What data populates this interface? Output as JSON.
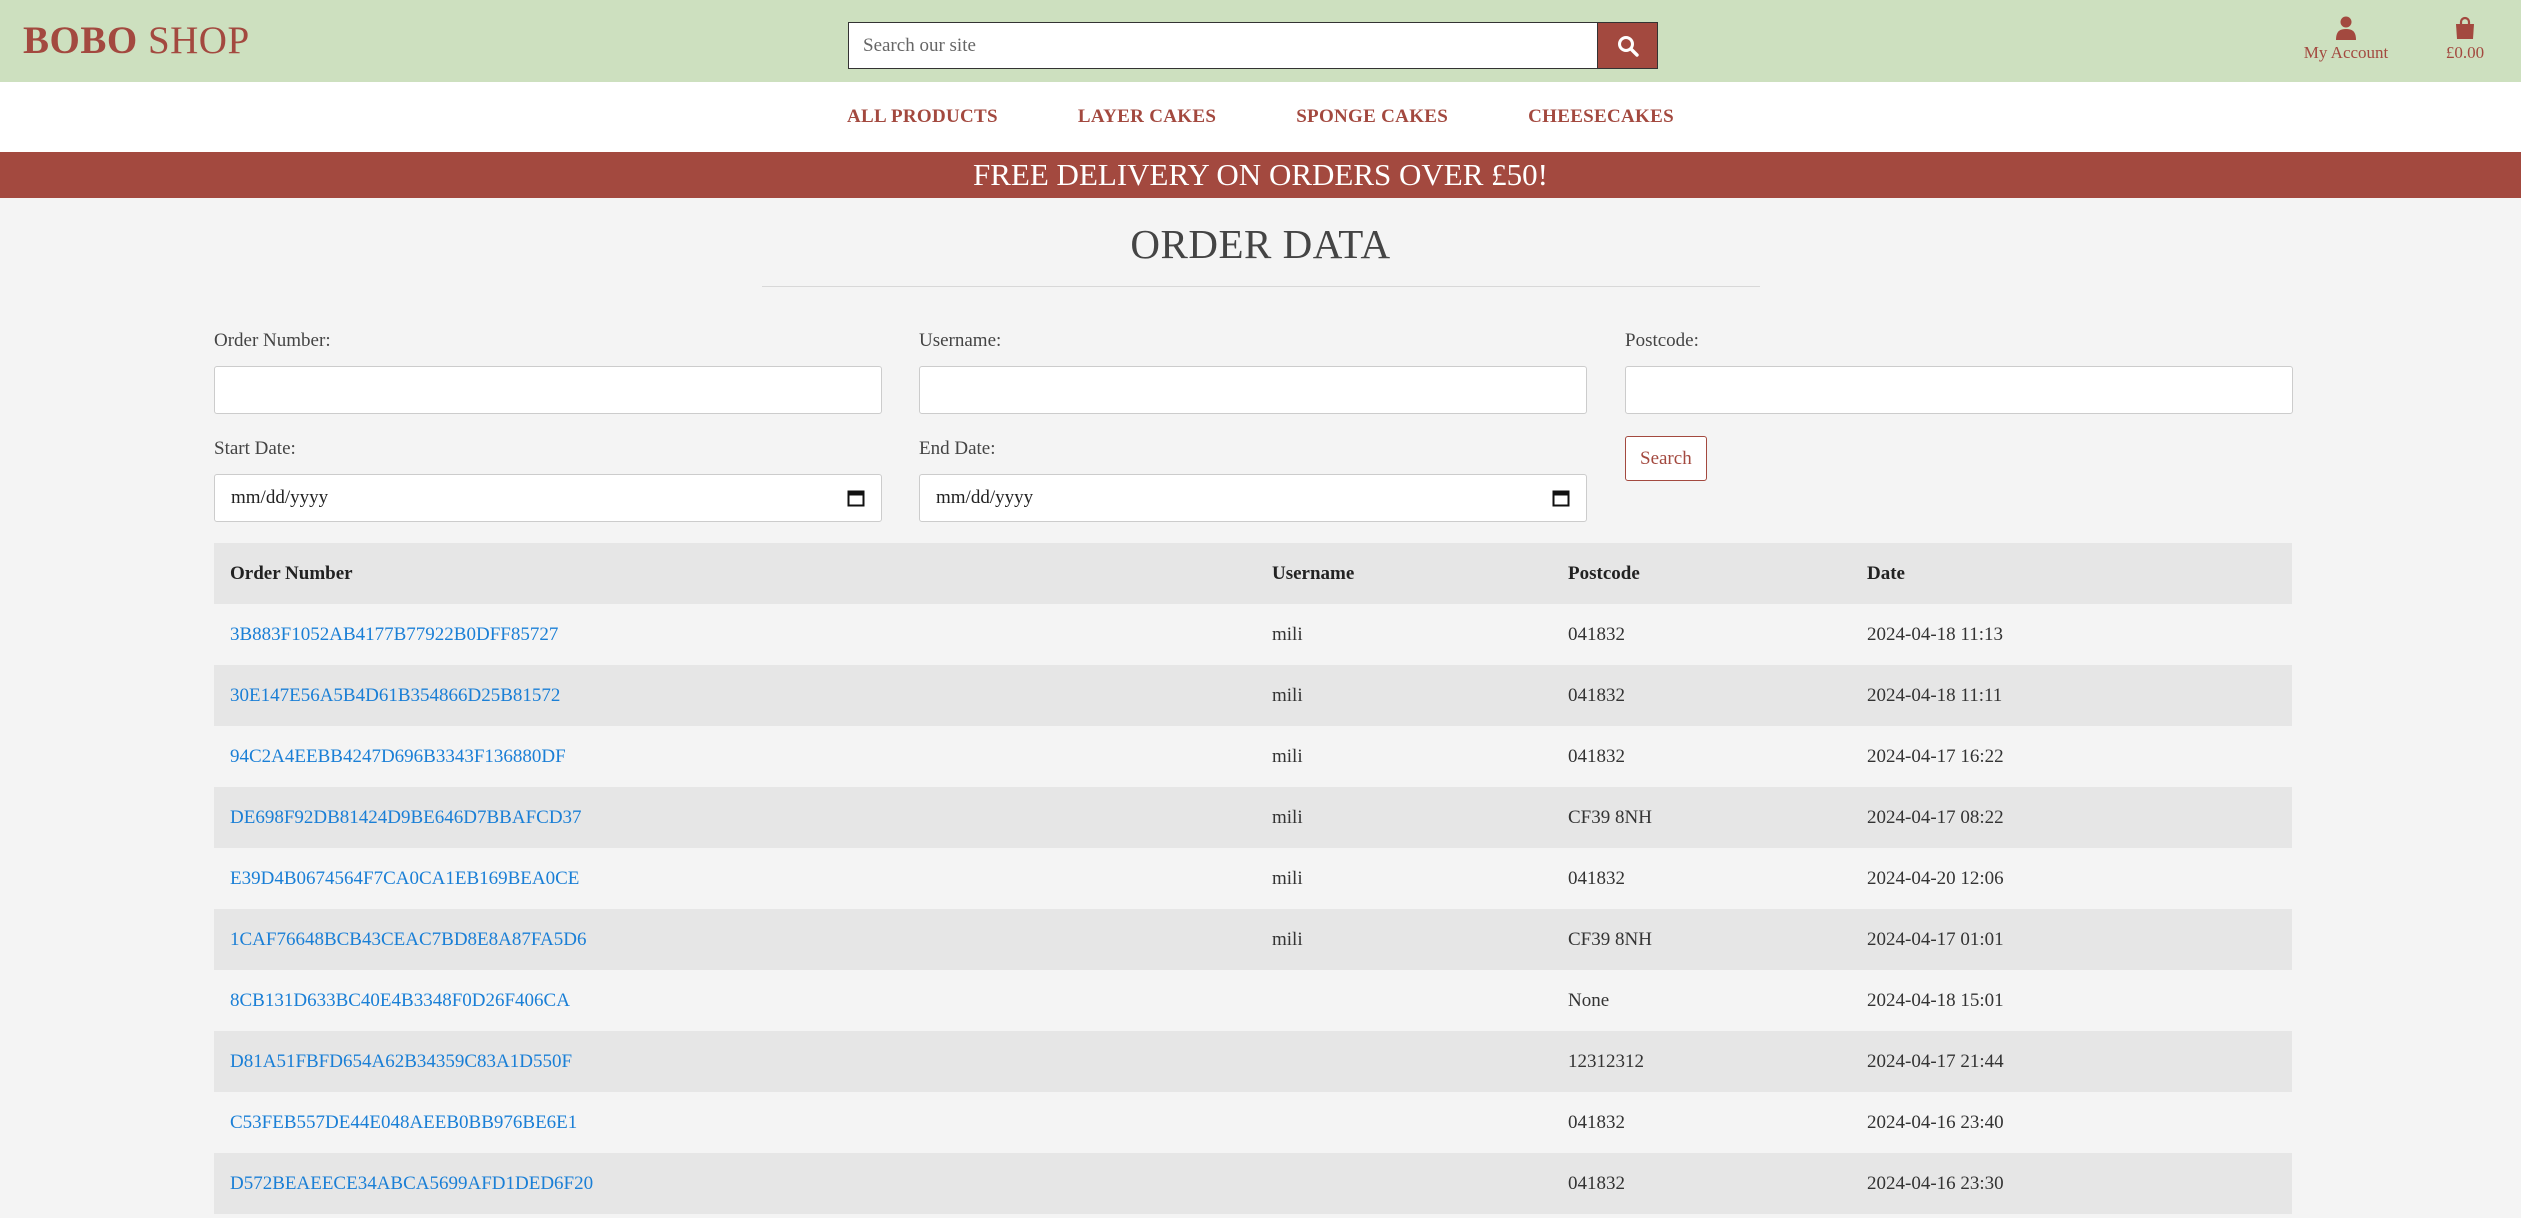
{
  "brand": {
    "bold": "BOBO",
    "rest": " SHOP"
  },
  "search": {
    "placeholder": "Search our site"
  },
  "account": {
    "label": "My Account"
  },
  "cart": {
    "total": "£0.00"
  },
  "nav": [
    "ALL PRODUCTS",
    "LAYER CAKES",
    "SPONGE CAKES",
    "CHEESECAKES"
  ],
  "banner": "FREE DELIVERY ON ORDERS OVER £50!",
  "page_title": "ORDER DATA",
  "filters": {
    "order_number_label": "Order Number:",
    "username_label": "Username:",
    "postcode_label": "Postcode:",
    "start_date_label": "Start Date:",
    "end_date_label": "End Date:",
    "date_placeholder": "mm/dd/yyyy",
    "search_button": "Search"
  },
  "table": {
    "headers": [
      "Order Number",
      "Username",
      "Postcode",
      "Date"
    ],
    "rows": [
      {
        "order": "3B883F1052AB4177B77922B0DFF85727",
        "user": "mili",
        "postcode": "041832",
        "date": "2024-04-18 11:13"
      },
      {
        "order": "30E147E56A5B4D61B354866D25B81572",
        "user": "mili",
        "postcode": "041832",
        "date": "2024-04-18 11:11"
      },
      {
        "order": "94C2A4EEBB4247D696B3343F136880DF",
        "user": "mili",
        "postcode": "041832",
        "date": "2024-04-17 16:22"
      },
      {
        "order": "DE698F92DB81424D9BE646D7BBAFCD37",
        "user": "mili",
        "postcode": "CF39 8NH",
        "date": "2024-04-17 08:22"
      },
      {
        "order": "E39D4B0674564F7CA0CA1EB169BEA0CE",
        "user": "mili",
        "postcode": "041832",
        "date": "2024-04-20 12:06"
      },
      {
        "order": "1CAF76648BCB43CEAC7BD8E8A87FA5D6",
        "user": "mili",
        "postcode": "CF39 8NH",
        "date": "2024-04-17 01:01"
      },
      {
        "order": "8CB131D633BC40E4B3348F0D26F406CA",
        "user": "",
        "postcode": "None",
        "date": "2024-04-18 15:01"
      },
      {
        "order": "D81A51FBFD654A62B34359C83A1D550F",
        "user": "",
        "postcode": "12312312",
        "date": "2024-04-17 21:44"
      },
      {
        "order": "C53FEB557DE44E048AEEB0BB976BE6E1",
        "user": "",
        "postcode": "041832",
        "date": "2024-04-16 23:40"
      },
      {
        "order": "D572BEAEECE34ABCA5699AFD1DED6F20",
        "user": "",
        "postcode": "041832",
        "date": "2024-04-16 23:30"
      }
    ]
  },
  "colors": {
    "brand": "#a3493f",
    "header_bg": "#cde0bf",
    "link": "#1a7fd6"
  },
  "icons": [
    "search-icon",
    "user-icon",
    "shopping-bag-icon",
    "calendar-icon"
  ]
}
